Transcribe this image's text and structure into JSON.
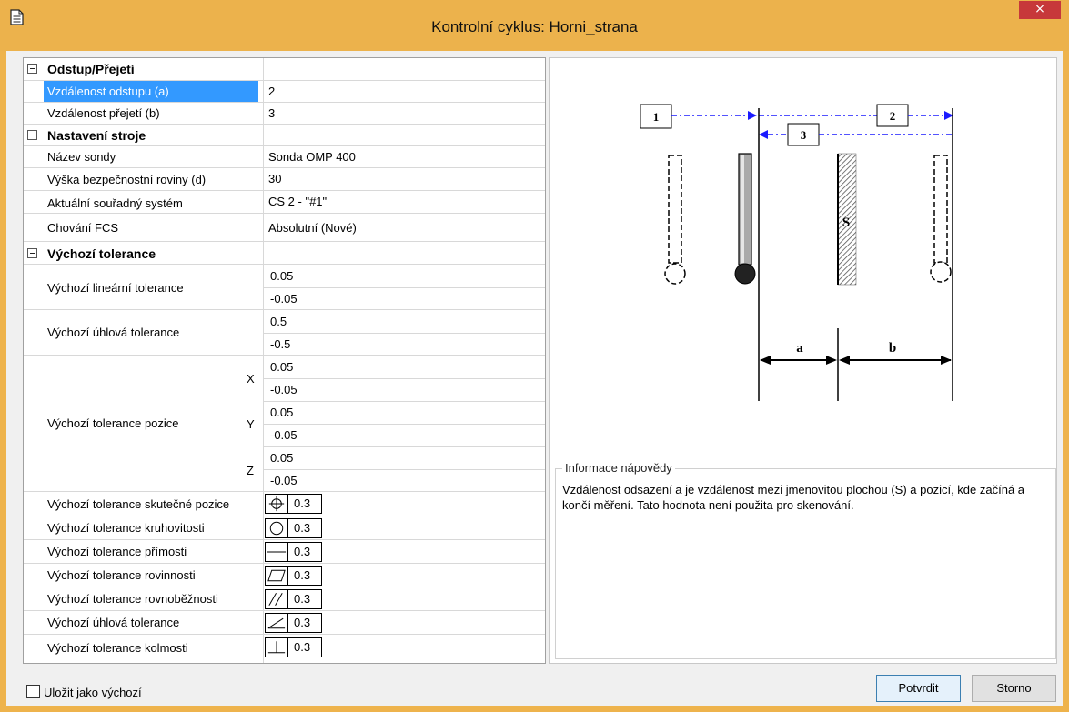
{
  "window": {
    "title": "Kontrolní cyklus: Horni_strana",
    "close_glyph": "×"
  },
  "grid": {
    "cat1": "Odstup/Přejetí",
    "retract_label": "Vzdálenost odstupu (a)",
    "retract_value": "2",
    "overtravel_label": "Vzdálenost přejetí (b)",
    "overtravel_value": "3",
    "cat2": "Nastavení stroje",
    "probe_label": "Název sondy",
    "probe_value": "Sonda OMP 400",
    "safe_label": "Výška bezpečnostní roviny (d)",
    "safe_value": "30",
    "cs_label": "Aktuální souřadný systém",
    "cs_value": "CS 2 - \"#1\"",
    "fcs_label": "Chování FCS",
    "fcs_value": "Absolutní (Nové)",
    "cat3": "Výchozí tolerance",
    "lin_label": "Výchozí lineární tolerance",
    "lin_upper": "0.05",
    "lin_lower": "-0.05",
    "ang_label": "Výchozí úhlová tolerance",
    "ang_upper": "0.5",
    "ang_lower": "-0.5",
    "pos_label": "Výchozí tolerance pozice",
    "axis_x": "X",
    "axis_y": "Y",
    "axis_z": "Z",
    "pos_x_upper": "0.05",
    "pos_x_lower": "-0.05",
    "pos_y_upper": "0.05",
    "pos_y_lower": "-0.05",
    "pos_z_upper": "0.05",
    "pos_z_lower": "-0.05",
    "true_pos_label": "Výchozí tolerance skutečné pozice",
    "true_pos_value": "0.3",
    "circ_label": "Výchozí tolerance kruhovitosti",
    "circ_value": "0.3",
    "straight_label": "Výchozí tolerance přímosti",
    "straight_value": "0.3",
    "flat_label": "Výchozí tolerance rovinnosti",
    "flat_value": "0.3",
    "par_label": "Výchozí tolerance rovnoběžnosti",
    "par_value": "0.3",
    "angular_label": "Výchozí úhlová tolerance",
    "angular_value": "0.3",
    "perp_label": "Výchozí tolerance kolmosti",
    "perp_value": "0.3"
  },
  "diagram": {
    "move1": "1",
    "move2": "2",
    "move3": "3",
    "surface": "S",
    "dim_a": "a",
    "dim_b": "b",
    "line_color": "#0000ff"
  },
  "help": {
    "title": "Informace nápovědy",
    "text": "Vzdálenost odsazení a je vzdálenost mezi jmenovitou plochou (S) a pozicí, kde začíná a končí měření. Tato hodnota není použita pro skenování."
  },
  "footer": {
    "save_default": "Uložit jako výchozí",
    "confirm": "Potvrdit",
    "cancel": "Storno"
  },
  "colors": {
    "title_bar": "#ecb24c",
    "selection": "#3399ff",
    "close": "#c7383a"
  }
}
